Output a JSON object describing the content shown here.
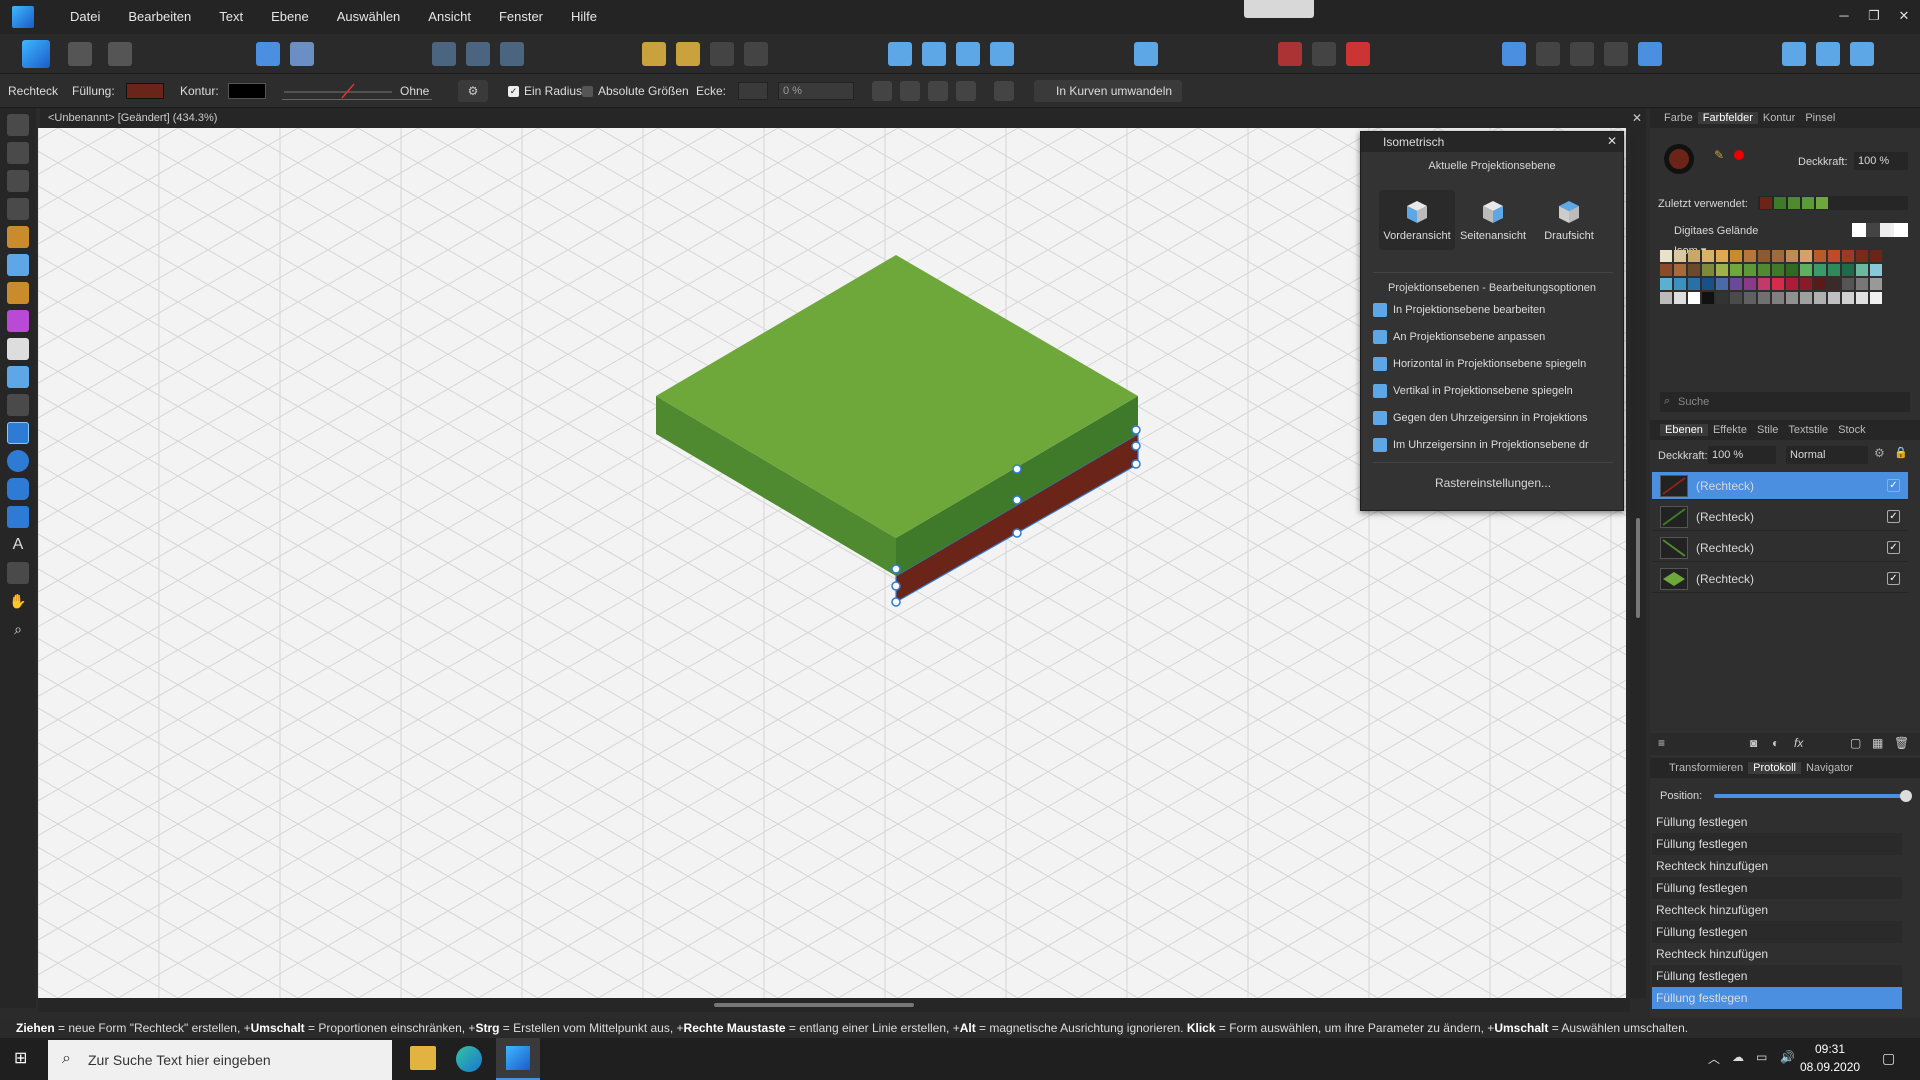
{
  "menubar": {
    "items": [
      "Datei",
      "Bearbeiten",
      "Text",
      "Ebene",
      "Auswählen",
      "Ansicht",
      "Fenster",
      "Hilfe"
    ]
  },
  "context_toolbar": {
    "shape_label": "Rechteck",
    "fill_label": "Füllung:",
    "stroke_label": "Kontur:",
    "stroke_style": "Ohne",
    "single_radius": "Ein Radius",
    "absolute_sizes": "Absolute Größen",
    "corner_label": "Ecke:",
    "corner_value": "0 %",
    "convert_button": "In Kurven umwandeln",
    "fill_color": "#6b2418",
    "stroke_color": "#000000"
  },
  "document": {
    "title": "<Unbenannt> [Geändert] (434.3%)"
  },
  "isometric_panel": {
    "title": "Isometrisch",
    "current_plane": "Aktuelle Projektionsebene",
    "planes": [
      "Vorderansicht",
      "Seitenansicht",
      "Draufsicht"
    ],
    "options_title": "Projektionsebenen - Bearbeitungsoptionen",
    "options": [
      "In Projektionsebene bearbeiten",
      "An Projektionsebene anpassen",
      "Horizontal in Projektionsebene spiegeln",
      "Vertikal in Projektionsebene spiegeln",
      "Gegen den Uhrzeigersinn in Projektions",
      "Im Uhrzeigersinn in Projektionsebene dr"
    ],
    "grid_button": "Rastereinstellungen..."
  },
  "color_panel": {
    "tabs": [
      "Farbe",
      "Farbfelder",
      "Kontur",
      "Pinsel"
    ],
    "opacity_label": "Deckkraft:",
    "opacity_value": "100 %",
    "recent_label": "Zuletzt verwendet:",
    "palette_name": "Digitaes Gelände Isom",
    "search_placeholder": "Suche"
  },
  "layers_panel": {
    "tabs": [
      "Ebenen",
      "Effekte",
      "Stile",
      "Textstile",
      "Stock"
    ],
    "opacity_label": "Deckkraft:",
    "opacity_value": "100 %",
    "blend_mode": "Normal",
    "layers": [
      "(Rechteck)",
      "(Rechteck)",
      "(Rechteck)",
      "(Rechteck)"
    ]
  },
  "history_panel": {
    "tabs": [
      "Transformieren",
      "Protokoll",
      "Navigator"
    ],
    "position_label": "Position:",
    "items": [
      "Füllung festlegen",
      "Füllung festlegen",
      "Rechteck hinzufügen",
      "Füllung festlegen",
      "Rechteck hinzufügen",
      "Füllung festlegen",
      "Rechteck hinzufügen",
      "Füllung festlegen",
      "Füllung festlegen"
    ]
  },
  "statusbar": {
    "parts": [
      {
        "b": "Ziehen",
        "t": " = neue Form \"Rechteck\" erstellen, +"
      },
      {
        "b": "Umschalt",
        "t": " = Proportionen einschränken, +"
      },
      {
        "b": "Strg",
        "t": " = Erstellen vom Mittelpunkt aus, +"
      },
      {
        "b": "Rechte Maustaste",
        "t": " = entlang einer Linie erstellen, +"
      },
      {
        "b": "Alt",
        "t": " = magnetische Ausrichtung ignorieren. "
      },
      {
        "b": "Klick",
        "t": " = Form auswählen, um ihre Parameter zu ändern, +"
      },
      {
        "b": "Umschalt",
        "t": " = Auswählen umschalten."
      }
    ]
  },
  "taskbar": {
    "search_placeholder": "Zur Suche Text hier eingeben",
    "time": "09:31",
    "date": "08.09.2020"
  },
  "colors": {
    "top_face": "#6fa83a",
    "left_face": "#4f8a30",
    "right_face": "#3f7a2a",
    "dirt": "#6b2418",
    "selection": "#2e7bd6",
    "accent": "#4a8fe0"
  }
}
